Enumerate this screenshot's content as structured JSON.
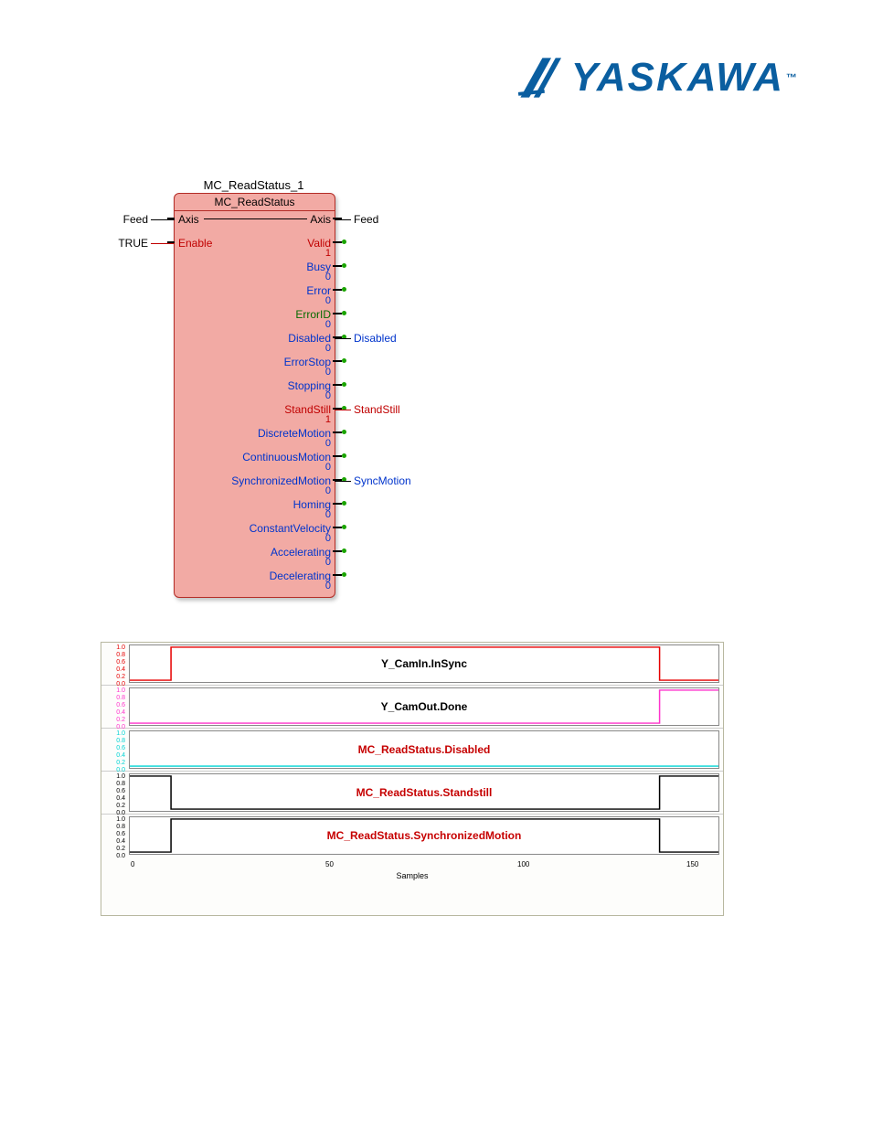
{
  "logo": {
    "text": "YASKAWA",
    "tm": "™"
  },
  "fb": {
    "instance_name": "MC_ReadStatus_1",
    "type_name": "MC_ReadStatus",
    "left_inputs": {
      "axis": {
        "label": "Axis",
        "ext": "Feed"
      },
      "enable": {
        "label": "Enable",
        "ext": "TRUE"
      }
    },
    "right_header": {
      "label": "Axis",
      "ext": "Feed"
    },
    "outputs": [
      {
        "name": "Valid",
        "value": "1",
        "color": "red",
        "ext": ""
      },
      {
        "name": "Busy",
        "value": "0",
        "color": "blue",
        "ext": ""
      },
      {
        "name": "Error",
        "value": "0",
        "color": "blue",
        "ext": ""
      },
      {
        "name": "ErrorID",
        "value": "0",
        "color": "green",
        "ext": ""
      },
      {
        "name": "Disabled",
        "value": "0",
        "color": "blue",
        "ext": "Disabled"
      },
      {
        "name": "ErrorStop",
        "value": "0",
        "color": "blue",
        "ext": ""
      },
      {
        "name": "Stopping",
        "value": "0",
        "color": "blue",
        "ext": ""
      },
      {
        "name": "StandStill",
        "value": "1",
        "color": "red",
        "ext": "StandStill"
      },
      {
        "name": "DiscreteMotion",
        "value": "0",
        "color": "blue",
        "ext": ""
      },
      {
        "name": "ContinuousMotion",
        "value": "0",
        "color": "blue",
        "ext": ""
      },
      {
        "name": "SynchronizedMotion",
        "value": "0",
        "color": "blue",
        "ext": "SyncMotion"
      },
      {
        "name": "Homing",
        "value": "0",
        "color": "blue",
        "ext": ""
      },
      {
        "name": "ConstantVelocity",
        "value": "0",
        "color": "blue",
        "ext": ""
      },
      {
        "name": "Accelerating",
        "value": "0",
        "color": "blue",
        "ext": ""
      },
      {
        "name": "Decelerating",
        "value": "0",
        "color": "blue",
        "ext": ""
      }
    ]
  },
  "scope": {
    "xlabel": "Samples",
    "xticks": [
      "0",
      "50",
      "100",
      "150"
    ],
    "yticks": [
      "1.0",
      "0.8",
      "0.6",
      "0.4",
      "0.2",
      "0.0"
    ],
    "traces": [
      {
        "title": "Y_CamIn.InSync",
        "title_color": "black",
        "signal_color": "#e60000",
        "step": {
          "rise": 0.07,
          "fall": 0.9
        }
      },
      {
        "title": "Y_CamOut.Done",
        "title_color": "black",
        "signal_color": "#ff33cc",
        "step": {
          "rise": 0.9
        }
      },
      {
        "title": "MC_ReadStatus.Disabled",
        "title_color": "red",
        "signal_color": "#00d4d4",
        "step": {}
      },
      {
        "title": "MC_ReadStatus.Standstill",
        "title_color": "red",
        "signal_color": "#000000",
        "step": {
          "high_until": 0.07,
          "rise": 0.9
        }
      },
      {
        "title": "MC_ReadStatus.SynchronizedMotion",
        "title_color": "red",
        "signal_color": "#000000",
        "step": {
          "rise": 0.07,
          "fall": 0.9
        }
      }
    ]
  },
  "chart_data": [
    {
      "type": "line",
      "title": "Y_CamIn.InSync",
      "xlabel": "Samples",
      "ylabel": "",
      "ylim": [
        0,
        1
      ],
      "xlim": [
        0,
        170
      ],
      "series": [
        {
          "name": "Y_CamIn.InSync",
          "x": [
            0,
            11,
            11,
            153,
            153,
            170
          ],
          "values": [
            0,
            0,
            1,
            1,
            0,
            0
          ]
        }
      ]
    },
    {
      "type": "line",
      "title": "Y_CamOut.Done",
      "xlabel": "Samples",
      "ylabel": "",
      "ylim": [
        0,
        1
      ],
      "xlim": [
        0,
        170
      ],
      "series": [
        {
          "name": "Y_CamOut.Done",
          "x": [
            0,
            153,
            153,
            170
          ],
          "values": [
            0,
            0,
            1,
            1
          ]
        }
      ]
    },
    {
      "type": "line",
      "title": "MC_ReadStatus.Disabled",
      "xlabel": "Samples",
      "ylabel": "",
      "ylim": [
        0,
        1
      ],
      "xlim": [
        0,
        170
      ],
      "series": [
        {
          "name": "MC_ReadStatus.Disabled",
          "x": [
            0,
            170
          ],
          "values": [
            0,
            0
          ]
        }
      ]
    },
    {
      "type": "line",
      "title": "MC_ReadStatus.Standstill",
      "xlabel": "Samples",
      "ylabel": "",
      "ylim": [
        0,
        1
      ],
      "xlim": [
        0,
        170
      ],
      "series": [
        {
          "name": "MC_ReadStatus.Standstill",
          "x": [
            0,
            11,
            11,
            153,
            153,
            170
          ],
          "values": [
            1,
            1,
            0,
            0,
            1,
            1
          ]
        }
      ]
    },
    {
      "type": "line",
      "title": "MC_ReadStatus.SynchronizedMotion",
      "xlabel": "Samples",
      "ylabel": "",
      "ylim": [
        0,
        1
      ],
      "xlim": [
        0,
        170
      ],
      "series": [
        {
          "name": "MC_ReadStatus.SynchronizedMotion",
          "x": [
            0,
            11,
            11,
            153,
            153,
            170
          ],
          "values": [
            0,
            0,
            1,
            1,
            0,
            0
          ]
        }
      ]
    }
  ]
}
